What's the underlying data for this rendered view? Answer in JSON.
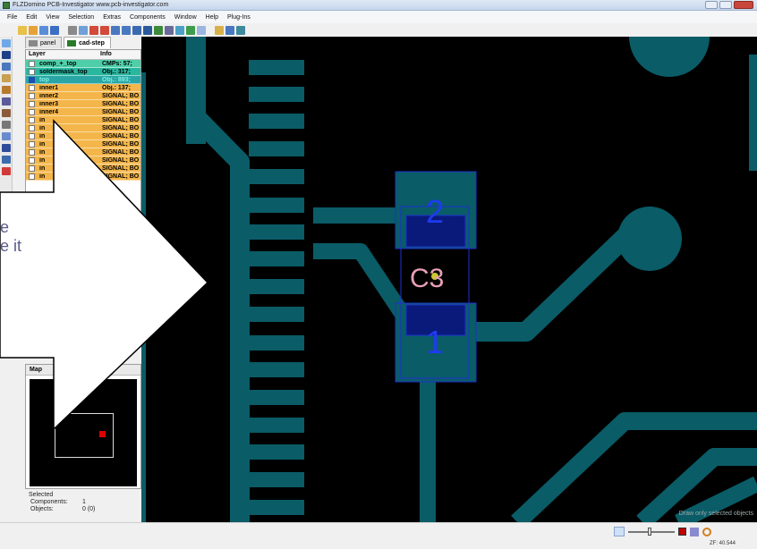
{
  "window": {
    "title": "FLZDomino  PCB-Investigator  www.pcb-investigator.com"
  },
  "menu": [
    "File",
    "Edit",
    "View",
    "Selection",
    "Extras",
    "Components",
    "Window",
    "Help",
    "Plug-Ins"
  ],
  "tabs": [
    {
      "label": "panel",
      "active": false
    },
    {
      "label": "cad-step",
      "active": true
    }
  ],
  "layer_panel": {
    "col_layer": "Layer",
    "col_info": "Info",
    "rows": [
      {
        "name": "comp_+_top",
        "info": "CMPs: 57;",
        "color": "#4ecfa9",
        "checked": false
      },
      {
        "name": "soldermask_top",
        "info": "Obj.: 317;",
        "color": "#29b7a0",
        "checked": false
      },
      {
        "name": "top",
        "info": "Obj.: 893;",
        "color": "#2aa5a5",
        "checked": true
      },
      {
        "name": "inner1",
        "info": "Obj.: 137;",
        "color": "#f4b64a",
        "checked": false
      },
      {
        "name": "inner2",
        "info": "SIGNAL; BO",
        "color": "#f4b64a",
        "checked": false
      },
      {
        "name": "inner3",
        "info": "SIGNAL; BO",
        "color": "#f4b64a",
        "checked": false
      },
      {
        "name": "inner4",
        "info": "SIGNAL; BO",
        "color": "#f4b64a",
        "checked": false
      },
      {
        "name": "in",
        "info": "SIGNAL; BO",
        "color": "#f4b64a",
        "checked": false
      },
      {
        "name": "in",
        "info": "SIGNAL; BO",
        "color": "#f4b64a",
        "checked": false
      },
      {
        "name": "in",
        "info": "SIGNAL; BO",
        "color": "#f4b64a",
        "checked": false
      },
      {
        "name": "in",
        "info": "SIGNAL; BO",
        "color": "#f4b64a",
        "checked": false
      },
      {
        "name": "in",
        "info": "SIGNAL; BO",
        "color": "#f4b64a",
        "checked": false
      },
      {
        "name": "in",
        "info": "SIGNAL; BO",
        "color": "#f4b64a",
        "checked": false
      },
      {
        "name": "in",
        "info": "SIGNAL; BO",
        "color": "#f4b64a",
        "checked": false
      },
      {
        "name": "in",
        "info": "SIGNAL; BO",
        "color": "#f4b64a",
        "checked": false
      }
    ]
  },
  "map": {
    "label": "Map"
  },
  "selected": {
    "title": "Selected",
    "components_label": "Components:",
    "components_value": "1",
    "objects_label": "Objects:",
    "objects_value": "0 (0)"
  },
  "canvas": {
    "component_ref": "C3",
    "pad1": "1",
    "pad2": "2",
    "overlay_text": "Draw only selected objects",
    "colors": {
      "trace": "#0a5c67",
      "pad_outline": "#1f2fd0",
      "pad_fill": "#0a1a7a",
      "label": "#e8a0b8"
    }
  },
  "callout": {
    "line1": "e",
    "line2": "e it"
  },
  "statusbar": {
    "zoom_factor": "ZF: 40.544"
  }
}
